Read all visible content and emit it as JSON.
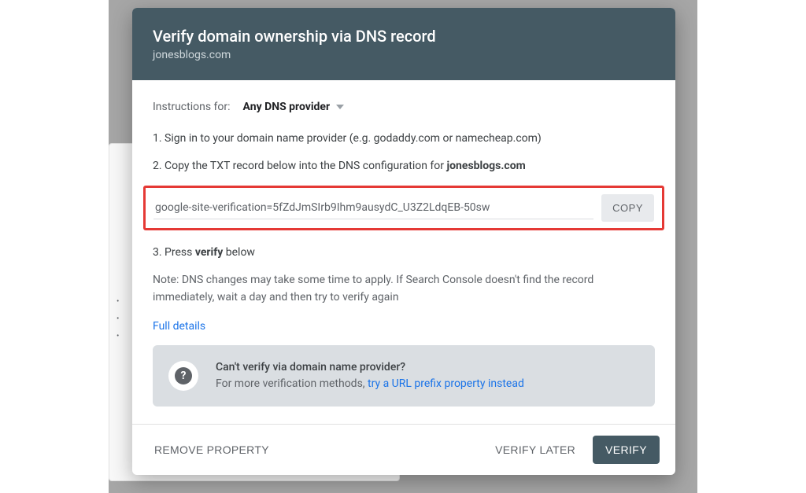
{
  "header": {
    "title": "Verify domain ownership via DNS record",
    "domain": "jonesblogs.com"
  },
  "provider": {
    "label": "Instructions for:",
    "selected": "Any DNS provider"
  },
  "steps": {
    "s1": "1. Sign in to your domain name provider (e.g. godaddy.com or namecheap.com)",
    "s2_prefix": "2. Copy the TXT record below into the DNS configuration for ",
    "s2_domain": "jonesblogs.com",
    "txt_value": "google-site-verification=5fZdJmSIrb9Ihm9ausydC_U3Z2LdqEB-50sw",
    "copy_label": "COPY",
    "s3_prefix": "3. Press ",
    "s3_bold": "verify",
    "s3_suffix": " below"
  },
  "note": "Note: DNS changes may take some time to apply. If Search Console doesn't find the record immediately, wait a day and then try to verify again",
  "full_details": "Full details",
  "alt": {
    "title": "Can't verify via domain name provider?",
    "lead": "For more verification methods, ",
    "link": "try a URL prefix property instead"
  },
  "footer": {
    "remove": "REMOVE PROPERTY",
    "later": "VERIFY LATER",
    "verify": "VERIFY"
  }
}
